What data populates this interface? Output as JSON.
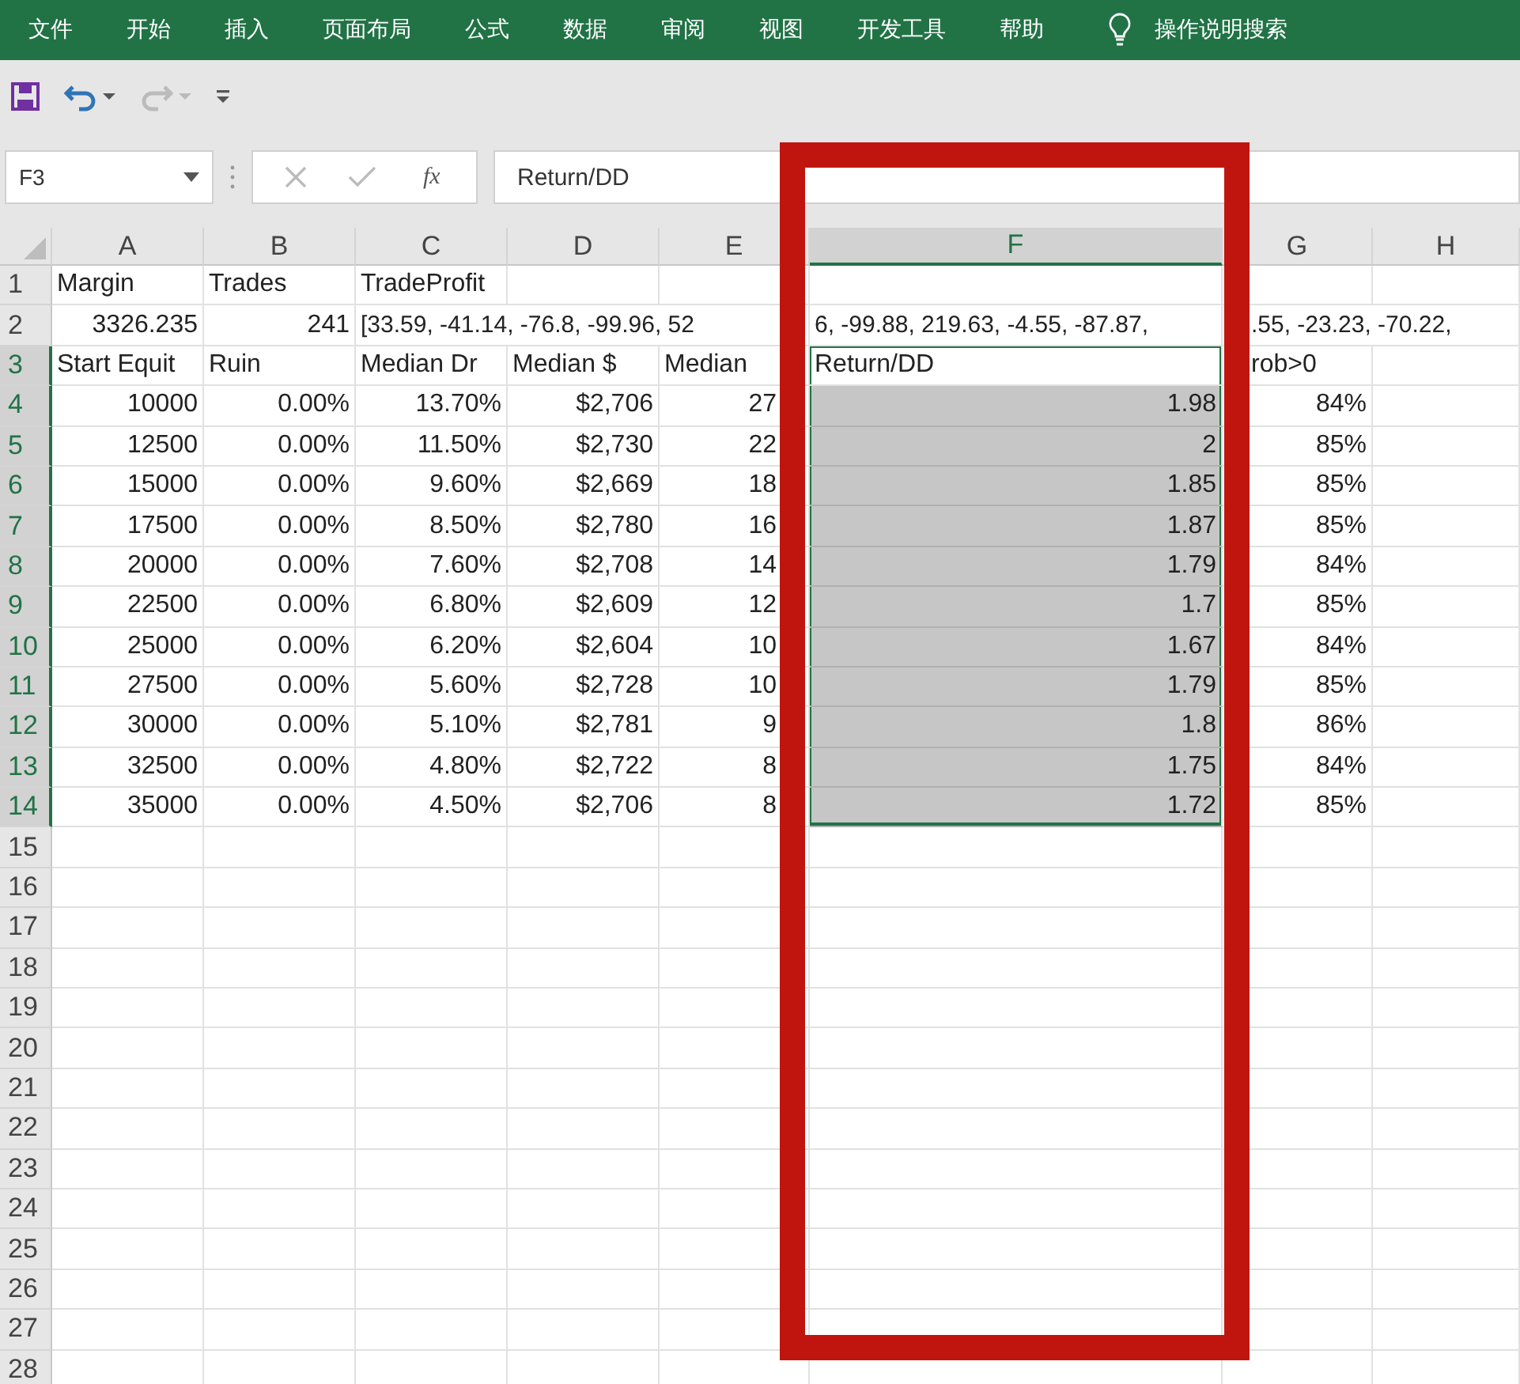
{
  "ribbon": {
    "tabs": [
      "文件",
      "开始",
      "插入",
      "页面布局",
      "公式",
      "数据",
      "审阅",
      "视图",
      "开发工具",
      "帮助"
    ],
    "tell_me": "操作说明搜索"
  },
  "formula_bar": {
    "name_box": "F3",
    "function_label": "fx",
    "formula": "Return/DD"
  },
  "columns": [
    {
      "label": "A",
      "selected": false
    },
    {
      "label": "B",
      "selected": false
    },
    {
      "label": "C",
      "selected": false
    },
    {
      "label": "D",
      "selected": false
    },
    {
      "label": "E",
      "selected": false
    },
    {
      "label": "F",
      "selected": true
    },
    {
      "label": "G",
      "selected": false
    },
    {
      "label": "H",
      "selected": false
    }
  ],
  "rows": [
    {
      "number": "1",
      "selected": false,
      "cells": {
        "A": {
          "text": "Margin",
          "kind": "text"
        },
        "B": {
          "text": "Trades",
          "kind": "text"
        },
        "C": {
          "text": "TradeProfit",
          "kind": "text"
        }
      }
    },
    {
      "number": "2",
      "selected": false,
      "cells": {
        "A": {
          "text": "3326.235",
          "kind": "number"
        },
        "B": {
          "text": "241",
          "kind": "number"
        },
        "C": {
          "text": "[33.59, -41.14, -76.8, -99.96, 52",
          "kind": "overflow"
        },
        "F": {
          "text": "6, -99.88, 219.63, -4.55, -87.87,",
          "kind": "overflow"
        },
        "G": {
          "text": ".55, -23.23, -70.22,",
          "kind": "overflow"
        }
      }
    },
    {
      "number": "3",
      "selected": true,
      "cells": {
        "A": {
          "text": "Start Equit",
          "kind": "text"
        },
        "B": {
          "text": "Ruin",
          "kind": "text"
        },
        "C": {
          "text": "Median Dr",
          "kind": "text"
        },
        "D": {
          "text": "Median $",
          "kind": "text"
        },
        "E": {
          "text": "Median",
          "kind": "text"
        },
        "F": {
          "text": "Return/DD",
          "kind": "text"
        },
        "G": {
          "text": "rob>0",
          "kind": "text"
        }
      }
    },
    {
      "number": "4",
      "selected": true,
      "cells": {
        "A": {
          "text": "10000",
          "kind": "number"
        },
        "B": {
          "text": "0.00%",
          "kind": "number"
        },
        "C": {
          "text": "13.70%",
          "kind": "number"
        },
        "D": {
          "text": "$2,706",
          "kind": "number"
        },
        "E": {
          "text": "27",
          "kind": "number"
        },
        "F": {
          "text": "1.98",
          "kind": "number"
        },
        "G": {
          "text": "84%",
          "kind": "number"
        }
      }
    },
    {
      "number": "5",
      "selected": true,
      "cells": {
        "A": {
          "text": "12500",
          "kind": "number"
        },
        "B": {
          "text": "0.00%",
          "kind": "number"
        },
        "C": {
          "text": "11.50%",
          "kind": "number"
        },
        "D": {
          "text": "$2,730",
          "kind": "number"
        },
        "E": {
          "text": "22",
          "kind": "number"
        },
        "F": {
          "text": "2",
          "kind": "number"
        },
        "G": {
          "text": "85%",
          "kind": "number"
        }
      }
    },
    {
      "number": "6",
      "selected": true,
      "cells": {
        "A": {
          "text": "15000",
          "kind": "number"
        },
        "B": {
          "text": "0.00%",
          "kind": "number"
        },
        "C": {
          "text": "9.60%",
          "kind": "number"
        },
        "D": {
          "text": "$2,669",
          "kind": "number"
        },
        "E": {
          "text": "18",
          "kind": "number"
        },
        "F": {
          "text": "1.85",
          "kind": "number"
        },
        "G": {
          "text": "85%",
          "kind": "number"
        }
      }
    },
    {
      "number": "7",
      "selected": true,
      "cells": {
        "A": {
          "text": "17500",
          "kind": "number"
        },
        "B": {
          "text": "0.00%",
          "kind": "number"
        },
        "C": {
          "text": "8.50%",
          "kind": "number"
        },
        "D": {
          "text": "$2,780",
          "kind": "number"
        },
        "E": {
          "text": "16",
          "kind": "number"
        },
        "F": {
          "text": "1.87",
          "kind": "number"
        },
        "G": {
          "text": "85%",
          "kind": "number"
        }
      }
    },
    {
      "number": "8",
      "selected": true,
      "cells": {
        "A": {
          "text": "20000",
          "kind": "number"
        },
        "B": {
          "text": "0.00%",
          "kind": "number"
        },
        "C": {
          "text": "7.60%",
          "kind": "number"
        },
        "D": {
          "text": "$2,708",
          "kind": "number"
        },
        "E": {
          "text": "14",
          "kind": "number"
        },
        "F": {
          "text": "1.79",
          "kind": "number"
        },
        "G": {
          "text": "84%",
          "kind": "number"
        }
      }
    },
    {
      "number": "9",
      "selected": true,
      "cells": {
        "A": {
          "text": "22500",
          "kind": "number"
        },
        "B": {
          "text": "0.00%",
          "kind": "number"
        },
        "C": {
          "text": "6.80%",
          "kind": "number"
        },
        "D": {
          "text": "$2,609",
          "kind": "number"
        },
        "E": {
          "text": "12",
          "kind": "number"
        },
        "F": {
          "text": "1.7",
          "kind": "number"
        },
        "G": {
          "text": "85%",
          "kind": "number"
        }
      }
    },
    {
      "number": "10",
      "selected": true,
      "cells": {
        "A": {
          "text": "25000",
          "kind": "number"
        },
        "B": {
          "text": "0.00%",
          "kind": "number"
        },
        "C": {
          "text": "6.20%",
          "kind": "number"
        },
        "D": {
          "text": "$2,604",
          "kind": "number"
        },
        "E": {
          "text": "10",
          "kind": "number"
        },
        "F": {
          "text": "1.67",
          "kind": "number"
        },
        "G": {
          "text": "84%",
          "kind": "number"
        }
      }
    },
    {
      "number": "11",
      "selected": true,
      "cells": {
        "A": {
          "text": "27500",
          "kind": "number"
        },
        "B": {
          "text": "0.00%",
          "kind": "number"
        },
        "C": {
          "text": "5.60%",
          "kind": "number"
        },
        "D": {
          "text": "$2,728",
          "kind": "number"
        },
        "E": {
          "text": "10",
          "kind": "number"
        },
        "F": {
          "text": "1.79",
          "kind": "number"
        },
        "G": {
          "text": "85%",
          "kind": "number"
        }
      }
    },
    {
      "number": "12",
      "selected": true,
      "cells": {
        "A": {
          "text": "30000",
          "kind": "number"
        },
        "B": {
          "text": "0.00%",
          "kind": "number"
        },
        "C": {
          "text": "5.10%",
          "kind": "number"
        },
        "D": {
          "text": "$2,781",
          "kind": "number"
        },
        "E": {
          "text": "9",
          "kind": "number"
        },
        "F": {
          "text": "1.8",
          "kind": "number"
        },
        "G": {
          "text": "86%",
          "kind": "number"
        }
      }
    },
    {
      "number": "13",
      "selected": true,
      "cells": {
        "A": {
          "text": "32500",
          "kind": "number"
        },
        "B": {
          "text": "0.00%",
          "kind": "number"
        },
        "C": {
          "text": "4.80%",
          "kind": "number"
        },
        "D": {
          "text": "$2,722",
          "kind": "number"
        },
        "E": {
          "text": "8",
          "kind": "number"
        },
        "F": {
          "text": "1.75",
          "kind": "number"
        },
        "G": {
          "text": "84%",
          "kind": "number"
        }
      }
    },
    {
      "number": "14",
      "selected": true,
      "cells": {
        "A": {
          "text": "35000",
          "kind": "number"
        },
        "B": {
          "text": "0.00%",
          "kind": "number"
        },
        "C": {
          "text": "4.50%",
          "kind": "number"
        },
        "D": {
          "text": "$2,706",
          "kind": "number"
        },
        "E": {
          "text": "8",
          "kind": "number"
        },
        "F": {
          "text": "1.72",
          "kind": "number"
        },
        "G": {
          "text": "85%",
          "kind": "number"
        }
      }
    },
    {
      "number": "15",
      "selected": false
    },
    {
      "number": "16",
      "selected": false
    },
    {
      "number": "17",
      "selected": false
    },
    {
      "number": "18",
      "selected": false
    },
    {
      "number": "19",
      "selected": false
    },
    {
      "number": "20",
      "selected": false
    },
    {
      "number": "21",
      "selected": false
    },
    {
      "number": "22",
      "selected": false
    },
    {
      "number": "23",
      "selected": false
    },
    {
      "number": "24",
      "selected": false
    },
    {
      "number": "25",
      "selected": false
    },
    {
      "number": "26",
      "selected": false
    },
    {
      "number": "27",
      "selected": false
    },
    {
      "number": "28",
      "selected": false
    }
  ]
}
